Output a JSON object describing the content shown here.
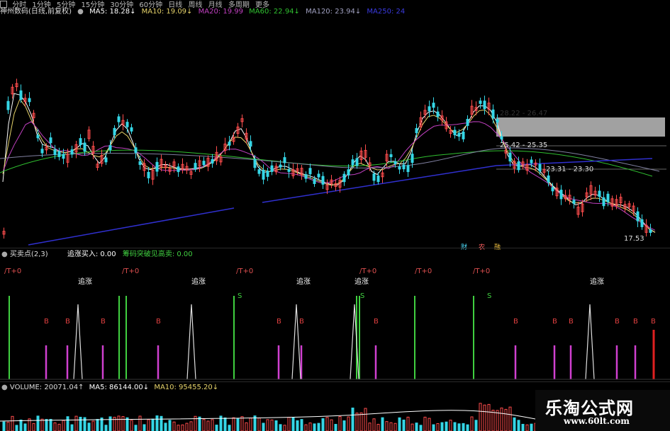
{
  "toolbar": {
    "items": [
      "分时",
      "1分钟",
      "5分钟",
      "15分钟",
      "30分钟",
      "60分钟",
      "日线",
      "周线",
      "月线",
      "多周期",
      "更多"
    ]
  },
  "ma_bar": {
    "stock": "神州数码(日线,前复权)",
    "ma5": "MA5: 18.28↓",
    "ma10": "MA10: 19.09↓",
    "ma20": "MA20: 19.99",
    "ma60": "MA60: 22.94↓",
    "ma120": "MA120: 23.94↓",
    "ma250": "MA250: 24"
  },
  "price_labels": {
    "band1": "28.22 - 26.47",
    "band2": "25.42 - 25.35",
    "band3": "23.31 - 23.30",
    "last": "17.53"
  },
  "event_markers": [
    "财",
    "农",
    "融"
  ],
  "indicator": {
    "title": "买卖点(2,3)",
    "v1": "追涨买入: 0.00",
    "v2": "筹码突破见高卖: 0.00",
    "signals": {
      "chase": "追涨",
      "buy": "B",
      "sell": "S",
      "jt": "/T+0"
    }
  },
  "volume": {
    "title": "VOLUME: 20071.04↑",
    "ma5": "MA5: 86144.00↓",
    "ma10": "MA10: 95455.20↓"
  },
  "watermark": {
    "title": "乐淘公式网",
    "url": "www.60lt.com"
  },
  "colors": {
    "up": "#ff4d4d",
    "down": "#35d6e6",
    "ma5": "#ffffff",
    "ma10": "#e6d36a",
    "ma20": "#c040c0",
    "ma60": "#30c030",
    "ma120": "#8080a0",
    "ma250": "#3030d0"
  }
}
